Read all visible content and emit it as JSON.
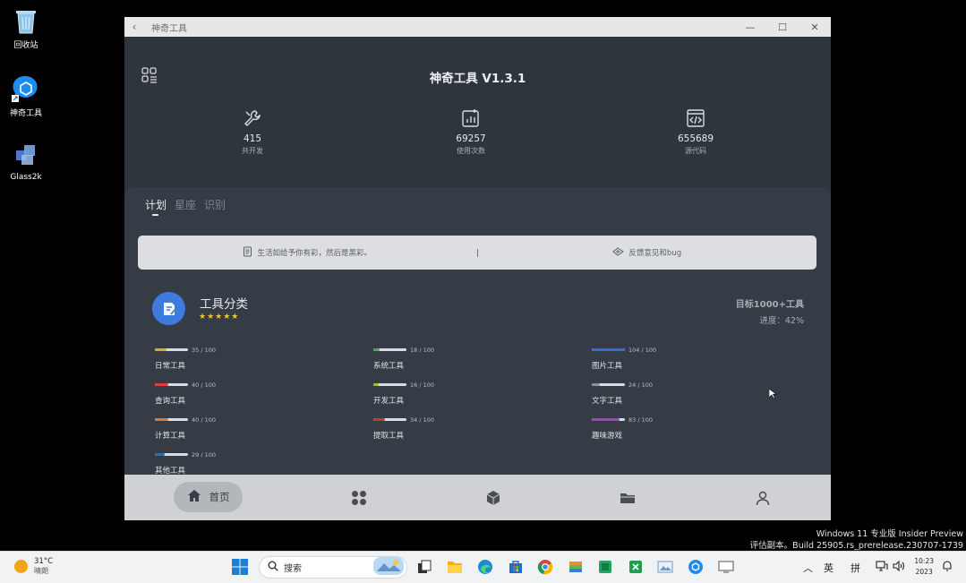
{
  "desktop": {
    "icons": [
      {
        "label": "回收站",
        "icon": "recycle-bin-icon"
      },
      {
        "label": "神奇工具",
        "icon": "app-shortcut-icon"
      },
      {
        "label": "Glass2k",
        "icon": "glass2k-icon"
      }
    ]
  },
  "window": {
    "title": "神奇工具",
    "controls": [
      "minimize",
      "maximize",
      "close"
    ]
  },
  "app": {
    "title": "神奇工具 V1.3.1",
    "stats": [
      {
        "value": "415",
        "label": "共开发",
        "icon": "wrench-icon"
      },
      {
        "value": "69257",
        "label": "使用次数",
        "icon": "chart-icon"
      },
      {
        "value": "655689",
        "label": "源代码",
        "icon": "code-window-icon"
      }
    ],
    "tabs": [
      {
        "label": "计划",
        "active": true
      },
      {
        "label": "星座",
        "active": false
      },
      {
        "label": "识别",
        "active": false
      }
    ],
    "notice": {
      "left": "生活如给予你有彩，然后是黑彩。",
      "right": "反馈意见和bug"
    },
    "category": {
      "title": "工具分类",
      "stars": "★★★★★",
      "goal": "目标1000+工具",
      "progress_label": "进度：42%",
      "progress": 42
    },
    "tools": [
      {
        "name": "日常工具",
        "count": "35 / 100",
        "value": 35,
        "color": "#e0a33a"
      },
      {
        "name": "系统工具",
        "count": "18 / 100",
        "value": 18,
        "color": "#3fae5f"
      },
      {
        "name": "图片工具",
        "count": "104 / 100",
        "value": 100,
        "color": "#2e6fd8"
      },
      {
        "name": "查询工具",
        "count": "40 / 100",
        "value": 40,
        "color": "#e03d3d"
      },
      {
        "name": "开发工具",
        "count": "16 / 100",
        "value": 16,
        "color": "#9bbf3a"
      },
      {
        "name": "文字工具",
        "count": "24 / 100",
        "value": 24,
        "color": "#8c9298"
      },
      {
        "name": "计算工具",
        "count": "40 / 100",
        "value": 40,
        "color": "#e07a2f"
      },
      {
        "name": "提取工具",
        "count": "34 / 100",
        "value": 34,
        "color": "#c8382d"
      },
      {
        "name": "趣味游戏",
        "count": "83 / 100",
        "value": 83,
        "color": "#a044c2"
      },
      {
        "name": "其他工具",
        "count": "29 / 100",
        "value": 29,
        "color": "#2d6fa8"
      }
    ],
    "nav": {
      "home_label": "首页"
    }
  },
  "watermark": {
    "line1": "Windows 11 专业版 Insider Preview",
    "line2": "评估副本。Build 25905.rs_prerelease.230707-1739"
  },
  "taskbar": {
    "weather_temp": "31°C",
    "weather_desc": "晴朗",
    "search_placeholder": "搜索",
    "ime_lang": "英",
    "ime_mode": "拼",
    "time": "10:23",
    "date": "2023"
  },
  "colors": {
    "window_bg": "#2f353c",
    "panel_bg": "#353c45",
    "accent_blue": "#3e7be0",
    "star": "#f3c12d"
  }
}
